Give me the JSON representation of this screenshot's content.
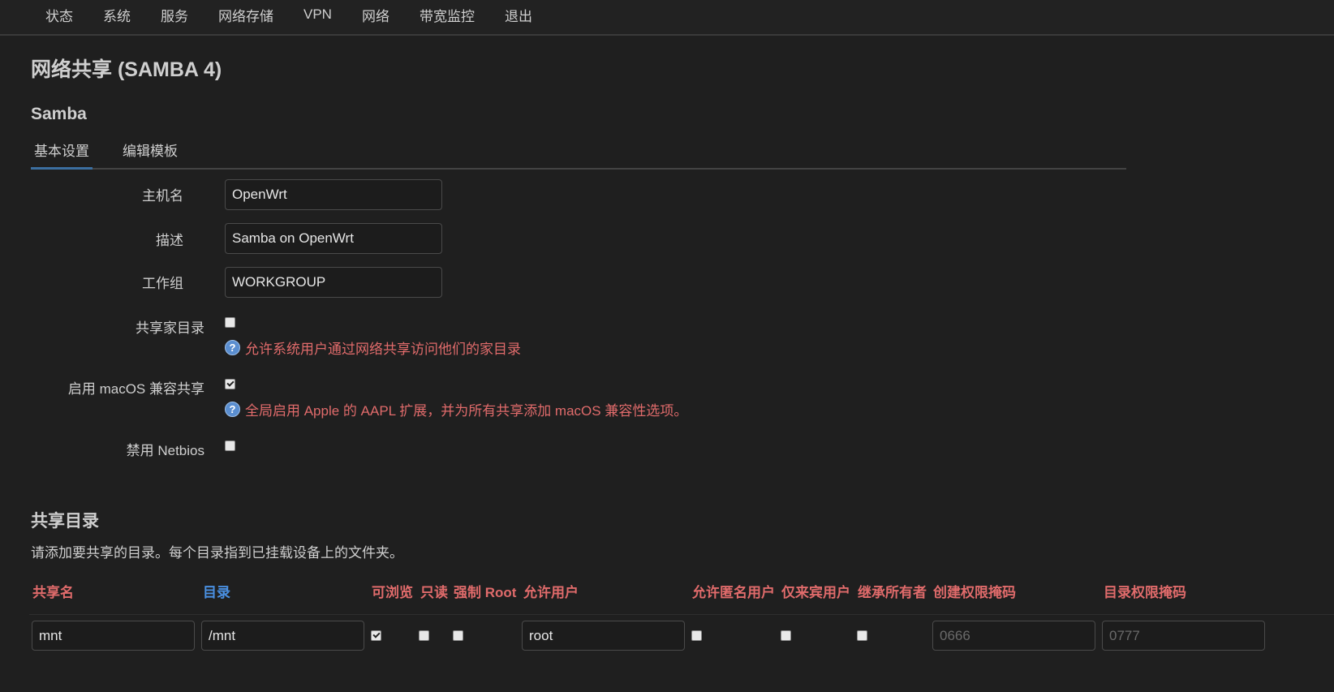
{
  "nav": [
    "状态",
    "系统",
    "服务",
    "网络存储",
    "VPN",
    "网络",
    "带宽监控",
    "退出"
  ],
  "page_title": "网络共享 (SAMBA 4)",
  "section_title": "Samba",
  "tabs": [
    "基本设置",
    "编辑模板"
  ],
  "form": {
    "hostname_label": "主机名",
    "hostname_value": "OpenWrt",
    "desc_label": "描述",
    "desc_value": "Samba on OpenWrt",
    "workgroup_label": "工作组",
    "workgroup_value": "WORKGROUP",
    "homes_label": "共享家目录",
    "homes_checked": false,
    "homes_hint": "允许系统用户通过网络共享访问他们的家目录",
    "macos_label": "启用 macOS 兼容共享",
    "macos_checked": true,
    "macos_hint": "全局启用 Apple 的 AAPL 扩展，并为所有共享添加 macOS 兼容性选项。",
    "netbios_label": "禁用 Netbios",
    "netbios_checked": false
  },
  "shares": {
    "title": "共享目录",
    "description": "请添加要共享的目录。每个目录指到已挂载设备上的文件夹。",
    "headers": [
      "共享名",
      "目录",
      "可浏览",
      "只读",
      "强制 Root",
      "允许用户",
      "允许匿名用户",
      "仅来宾用户",
      "继承所有者",
      "创建权限掩码",
      "目录权限掩码"
    ],
    "row": {
      "name": "mnt",
      "path": "/mnt",
      "browseable": true,
      "readonly": false,
      "force_root": false,
      "users": "root",
      "guest_ok": false,
      "guest_only": false,
      "inherit_owner": false,
      "create_mask_placeholder": "0666",
      "dir_mask_placeholder": "0777"
    }
  }
}
